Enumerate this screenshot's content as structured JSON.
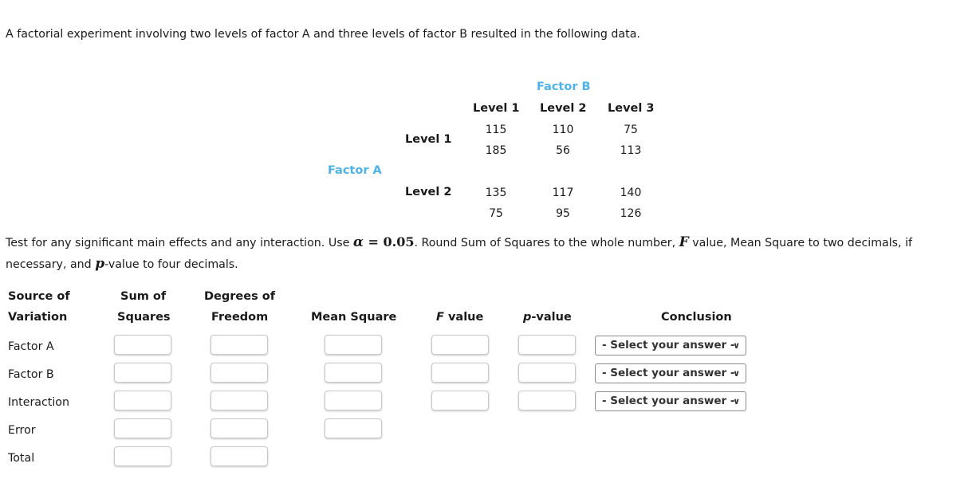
{
  "intro": "A factorial experiment involving two levels of factor A and three levels of factor B resulted in the following data.",
  "data_table": {
    "factor_b_label": "Factor B",
    "factor_a_label": "Factor A",
    "column_headers": [
      "Level 1",
      "Level 2",
      "Level 3"
    ],
    "rows": [
      {
        "label": "Level 1",
        "values": [
          [
            "115",
            "110",
            "75"
          ],
          [
            "185",
            "56",
            "113"
          ]
        ]
      },
      {
        "label": "Level 2",
        "values": [
          [
            "135",
            "117",
            "140"
          ],
          [
            "75",
            "95",
            "126"
          ]
        ]
      }
    ]
  },
  "instructions": {
    "part1": "Test for any significant main effects and any interaction. Use ",
    "alpha_symbol": "α",
    "equals": " = ",
    "alpha_value": "0.05",
    "part2": ". Round Sum of Squares to the whole number, ",
    "f_symbol": "F",
    "part3": " value, Mean Square to two decimals, if necessary, and ",
    "p_symbol": "p",
    "part4": "-value to four decimals."
  },
  "anova_table": {
    "headers": {
      "source_line1": "Source of",
      "source_line2": "Variation",
      "ss_line1": "Sum of",
      "ss_line2": "Squares",
      "df_line1": "Degrees of",
      "df_line2": "Freedom",
      "ms": "Mean Square",
      "f_symbol": "F",
      "f_rest": " value",
      "p_symbol": "p",
      "p_rest": "-value",
      "conclusion": "Conclusion"
    },
    "rows": [
      {
        "source": "Factor A",
        "ss": "",
        "df": "",
        "ms": "",
        "f": "",
        "p": "",
        "conclusion": "- Select your answer -"
      },
      {
        "source": "Factor B",
        "ss": "",
        "df": "",
        "ms": "",
        "f": "",
        "p": "",
        "conclusion": "- Select your answer -"
      },
      {
        "source": "Interaction",
        "ss": "",
        "df": "",
        "ms": "",
        "f": "",
        "p": "",
        "conclusion": "- Select your answer -"
      },
      {
        "source": "Error",
        "ss": "",
        "df": "",
        "ms": ""
      },
      {
        "source": "Total",
        "ss": "",
        "df": ""
      }
    ]
  },
  "icons": {
    "dropdown": "chevron-down-icon"
  }
}
